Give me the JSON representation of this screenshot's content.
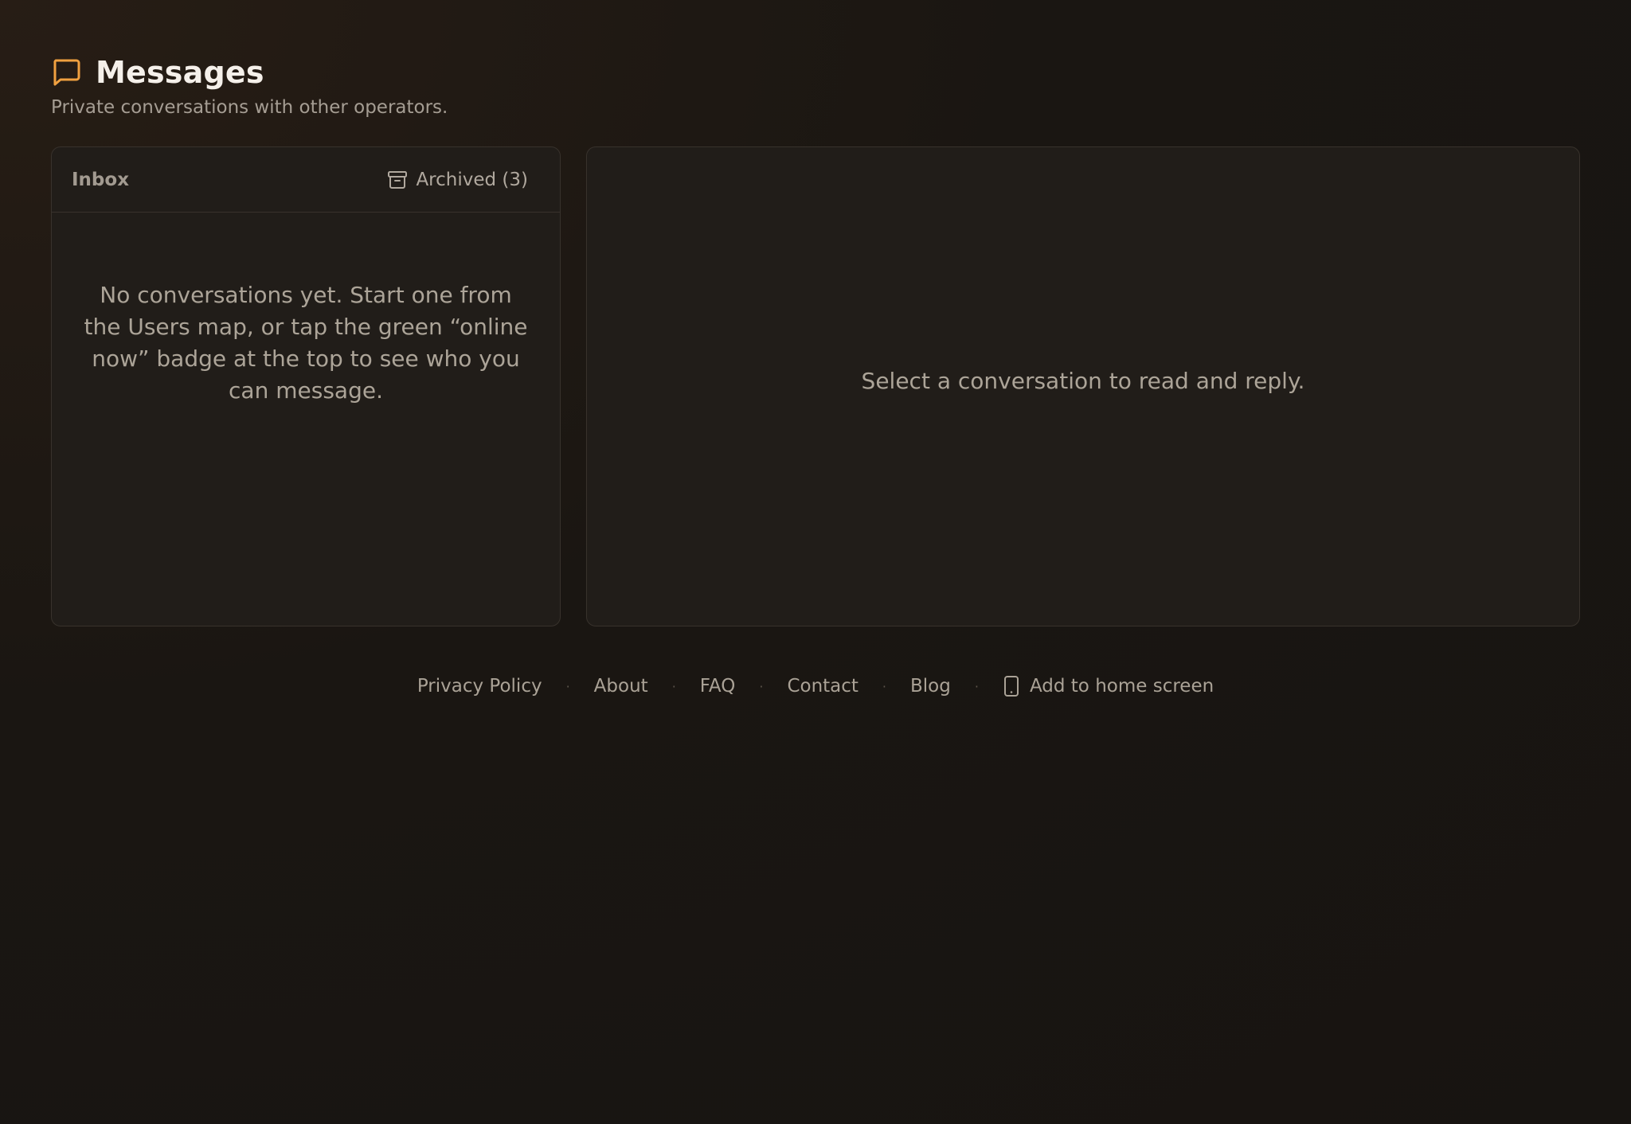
{
  "header": {
    "title": "Messages",
    "subtitle": "Private conversations with other operators.",
    "icon": "chat-bubble-icon",
    "accent_color": "#f0a040"
  },
  "inbox": {
    "tab_label": "Inbox",
    "archived_label": "Archived (3)",
    "archived_icon": "archive-box-icon",
    "empty_message": "No conversations yet. Start one from the Users map, or tap the green “online now” badge at the top to see who you can message."
  },
  "detail": {
    "placeholder": "Select a conversation to read and reply."
  },
  "footer": {
    "links": [
      {
        "label": "Privacy Policy"
      },
      {
        "label": "About"
      },
      {
        "label": "FAQ"
      },
      {
        "label": "Contact"
      },
      {
        "label": "Blog"
      }
    ],
    "separator": "·",
    "home_screen_label": "Add to home screen",
    "home_screen_icon": "phone-icon"
  }
}
